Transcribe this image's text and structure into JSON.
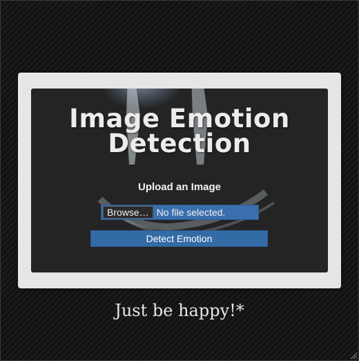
{
  "app": {
    "title_line1": "Image Emotion",
    "title_line2": "Detection"
  },
  "upload": {
    "label": "Upload an Image",
    "browse_label": "Browse…",
    "file_status": "No file selected."
  },
  "actions": {
    "detect_label": "Detect Emotion"
  },
  "footer": {
    "tagline": "Just be happy!*"
  },
  "colors": {
    "accent_blue": "#336ba6",
    "card_outer": "#e6e6e6",
    "card_inner": "#242424"
  },
  "icons": {
    "splash": "chalk-smiley-splash",
    "grip": "resize-grip-icon"
  }
}
